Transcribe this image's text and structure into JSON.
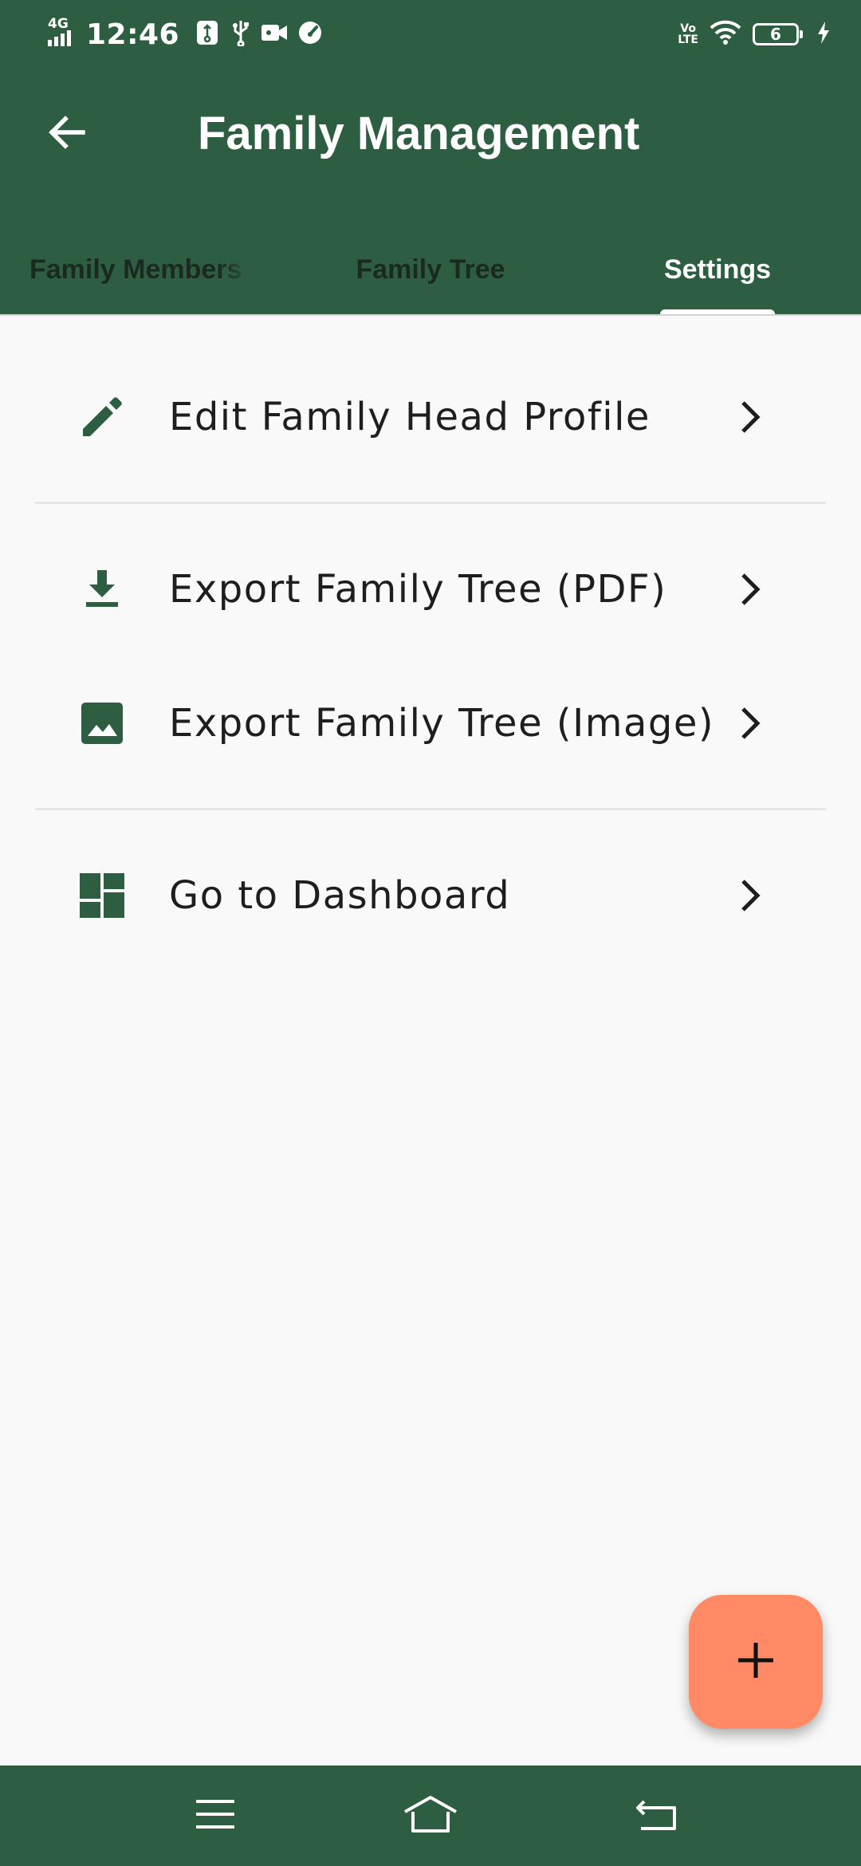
{
  "status_bar": {
    "network": "4G",
    "time": "12:46",
    "volte": [
      "Vo",
      "LTE"
    ],
    "battery": "6"
  },
  "app_bar": {
    "title": "Family Management",
    "back_icon": "arrow-back-icon"
  },
  "tabs": [
    {
      "label": "Family Members",
      "selected": false
    },
    {
      "label": "Family Tree",
      "selected": false
    },
    {
      "label": "Settings",
      "selected": true
    }
  ],
  "settings": {
    "items": [
      {
        "icon": "pencil-icon",
        "label": "Edit Family Head Profile"
      },
      {
        "icon": "download-icon",
        "label": "Export Family Tree (PDF)"
      },
      {
        "icon": "image-icon",
        "label": "Export Family Tree (Image)"
      },
      {
        "icon": "dashboard-icon",
        "label": "Go to Dashboard"
      }
    ]
  },
  "fab": {
    "icon": "plus-icon"
  },
  "colors": {
    "primary": "#2e5e42",
    "fab": "#ff8a65",
    "background": "#f9f9f9"
  },
  "nav_bar": {
    "buttons": [
      "menu-icon",
      "home-icon",
      "back-nav-icon"
    ]
  }
}
